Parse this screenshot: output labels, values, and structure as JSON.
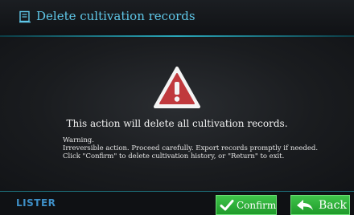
{
  "header": {
    "title": "Delete cultivation records",
    "icon": "document-icon",
    "accent_color": "#5fc7e8"
  },
  "main": {
    "icon": "warning-triangle-icon",
    "message": "This action will delete all cultivation records.",
    "warning": {
      "heading": "Warning.",
      "lines": [
        "Irreversible action. Proceed carefully. Export records promptly if needed.",
        "Click \"Confirm\" to delete cultivation history, or \"Return\" to exit."
      ]
    }
  },
  "footer": {
    "logo": "LISTER",
    "confirm_label": "Confirm",
    "confirm_icon": "checkmark-icon",
    "back_label": "Back",
    "back_icon": "return-arrow-icon",
    "button_color": "#2fb23b"
  }
}
